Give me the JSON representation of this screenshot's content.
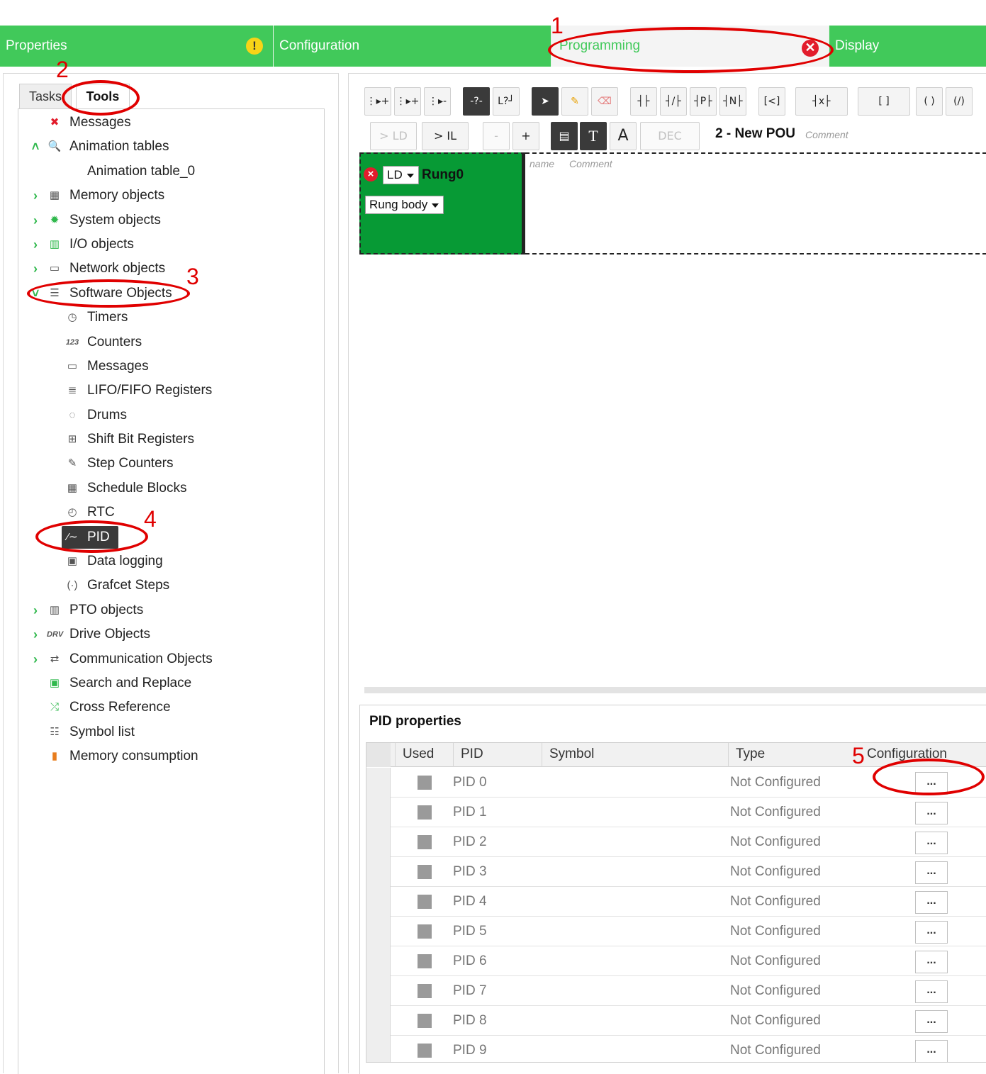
{
  "ribbon": {
    "tabs": [
      {
        "label": "Properties",
        "status": "warning"
      },
      {
        "label": "Configuration"
      },
      {
        "label": "Programming",
        "status": "error",
        "active": true
      },
      {
        "label": "Display"
      }
    ]
  },
  "left": {
    "subtabs": [
      "Tasks",
      "Tools"
    ],
    "selected_subtab": "Tools",
    "tree": [
      {
        "label": "Messages",
        "icon": "error-icon"
      },
      {
        "label": "Animation tables",
        "icon": "magnifier-icon",
        "chevron": "^"
      },
      {
        "label": "Animation table_0"
      },
      {
        "label": "Memory objects",
        "icon": "memory-icon",
        "chevron": ">"
      },
      {
        "label": "System objects",
        "icon": "gear-icon",
        "chevron": ">"
      },
      {
        "label": "I/O objects",
        "icon": "io-icon",
        "chevron": ">"
      },
      {
        "label": "Network objects",
        "icon": "network-icon",
        "chevron": ">"
      },
      {
        "label": "Software Objects",
        "icon": "software-icon",
        "chevron": "v"
      },
      {
        "label": "Timers",
        "icon": "clock-icon"
      },
      {
        "label": "Counters",
        "icon": "counter-icon"
      },
      {
        "label": "Messages",
        "icon": "message-icon"
      },
      {
        "label": "LIFO/FIFO Registers",
        "icon": "register-icon"
      },
      {
        "label": "Drums",
        "icon": "drum-icon"
      },
      {
        "label": "Shift Bit Registers",
        "icon": "shift-icon"
      },
      {
        "label": "Step Counters",
        "icon": "step-icon"
      },
      {
        "label": "Schedule Blocks",
        "icon": "calendar-icon"
      },
      {
        "label": "RTC",
        "icon": "rtc-icon"
      },
      {
        "label": "PID",
        "icon": "pid-icon",
        "selected": true
      },
      {
        "label": "Data logging",
        "icon": "datalog-icon"
      },
      {
        "label": "Grafcet Steps",
        "icon": "grafcet-icon"
      },
      {
        "label": "PTO objects",
        "icon": "pto-icon",
        "chevron": ">"
      },
      {
        "label": "Drive Objects",
        "icon": "drive-icon",
        "chevron": ">"
      },
      {
        "label": "Communication Objects",
        "icon": "comm-icon",
        "chevron": ">"
      },
      {
        "label": "Search and Replace",
        "icon": "search-replace-icon"
      },
      {
        "label": "Cross Reference",
        "icon": "cross-ref-icon"
      },
      {
        "label": "Symbol list",
        "icon": "list-icon"
      },
      {
        "label": "Memory consumption",
        "icon": "bar-icon"
      }
    ]
  },
  "editor": {
    "toolbar1": [
      "⋮▸+",
      "⋮▸+",
      "⋮▸-",
      "-?-",
      "L?┘",
      "➤",
      "✎",
      "⌫",
      "┤├",
      "┤/├",
      "┤P├",
      "┤N├",
      "[<]",
      "┤x├",
      "[ ]",
      "( )",
      "(/)"
    ],
    "toolbar2": {
      "ld": "> LD",
      "il": "> IL",
      "minus": "-",
      "plus": "+",
      "dec": "DEC"
    },
    "pou_title": "2 - New POU",
    "pou_comment": "Comment",
    "rung": {
      "lang": "LD",
      "name": "Rung0",
      "body_select": "Rung body",
      "name_label": "name",
      "comment_label": "Comment"
    }
  },
  "pid_props": {
    "title": "PID properties",
    "columns": [
      "Used",
      "PID",
      "Symbol",
      "Type",
      "Configuration"
    ],
    "rows": [
      {
        "pid": "PID 0",
        "symbol": "",
        "type": "Not Configured",
        "btn": "..."
      },
      {
        "pid": "PID 1",
        "symbol": "",
        "type": "Not Configured",
        "btn": "..."
      },
      {
        "pid": "PID 2",
        "symbol": "",
        "type": "Not Configured",
        "btn": "..."
      },
      {
        "pid": "PID 3",
        "symbol": "",
        "type": "Not Configured",
        "btn": "..."
      },
      {
        "pid": "PID 4",
        "symbol": "",
        "type": "Not Configured",
        "btn": "..."
      },
      {
        "pid": "PID 5",
        "symbol": "",
        "type": "Not Configured",
        "btn": "..."
      },
      {
        "pid": "PID 6",
        "symbol": "",
        "type": "Not Configured",
        "btn": "..."
      },
      {
        "pid": "PID 7",
        "symbol": "",
        "type": "Not Configured",
        "btn": "..."
      },
      {
        "pid": "PID 8",
        "symbol": "",
        "type": "Not Configured",
        "btn": "..."
      },
      {
        "pid": "PID 9",
        "symbol": "",
        "type": "Not Configured",
        "btn": "..."
      }
    ]
  },
  "annotations": [
    "1",
    "2",
    "3",
    "4",
    "5"
  ]
}
